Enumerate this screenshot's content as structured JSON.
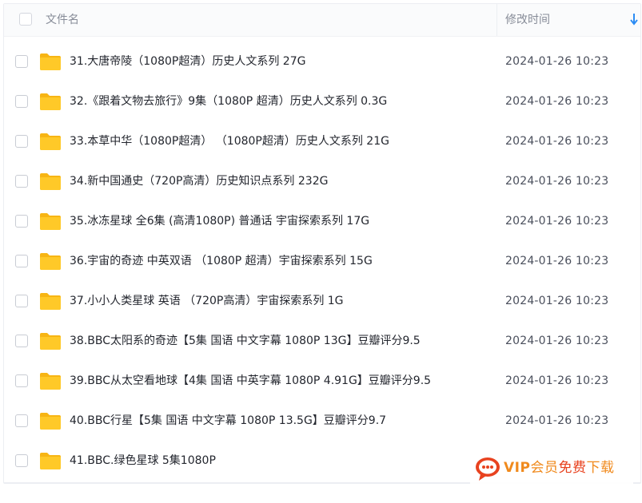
{
  "header": {
    "name_col": "文件名",
    "time_col": "修改时间",
    "sort_icon": "arrow-down-icon"
  },
  "colors": {
    "folder": "#ffc928",
    "folder_back": "#f7b514",
    "sort_arrow": "#2c8cf4",
    "watermark_orange": "#f08a1d",
    "watermark_red": "#e8421f"
  },
  "rows": [
    {
      "name": "31.大唐帝陵（1080P超清）历史人文系列 27G",
      "time": "2024-01-26 10:23"
    },
    {
      "name": "32.《跟着文物去旅行》9集（1080P 超清）历史人文系列 0.3G",
      "time": "2024-01-26 10:23"
    },
    {
      "name": "33.本草中华（1080P超清）  （1080P超清）历史人文系列 21G",
      "time": "2024-01-26 10:23"
    },
    {
      "name": "34.新中国通史（720P高清）历史知识点系列 232G",
      "time": "2024-01-26 10:23"
    },
    {
      "name": "35.冰冻星球 全6集 (高清1080P) 普通话 宇宙探索系列 17G",
      "time": "2024-01-26 10:23"
    },
    {
      "name": "36.宇宙的奇迹 中英双语  （1080P 超清）宇宙探索系列 15G",
      "time": "2024-01-26 10:23"
    },
    {
      "name": "37.小小人类星球 英语  （720P高清）宇宙探索系列 1G",
      "time": "2024-01-26 10:23"
    },
    {
      "name": "38.BBC太阳系的奇迹【5集 国语 中文字幕 1080P 13G】豆瓣评分9.5",
      "time": "2024-01-26 10:23"
    },
    {
      "name": "39.BBC从太空看地球【4集 国语 中英字幕 1080P  4.91G】豆瓣评分9.5",
      "time": "2024-01-26 10:23"
    },
    {
      "name": "40.BBC行星【5集 国语 中文字幕 1080P 13.5G】豆瓣评分9.7",
      "time": "2024-01-26 10:23"
    },
    {
      "name": "41.BBC.绿色星球 5集1080P",
      "time": ""
    }
  ],
  "watermark": {
    "vip": "VIP",
    "member": "会员",
    "free": "免费",
    "download": "下载",
    "icon": "chat-bubble-icon"
  }
}
